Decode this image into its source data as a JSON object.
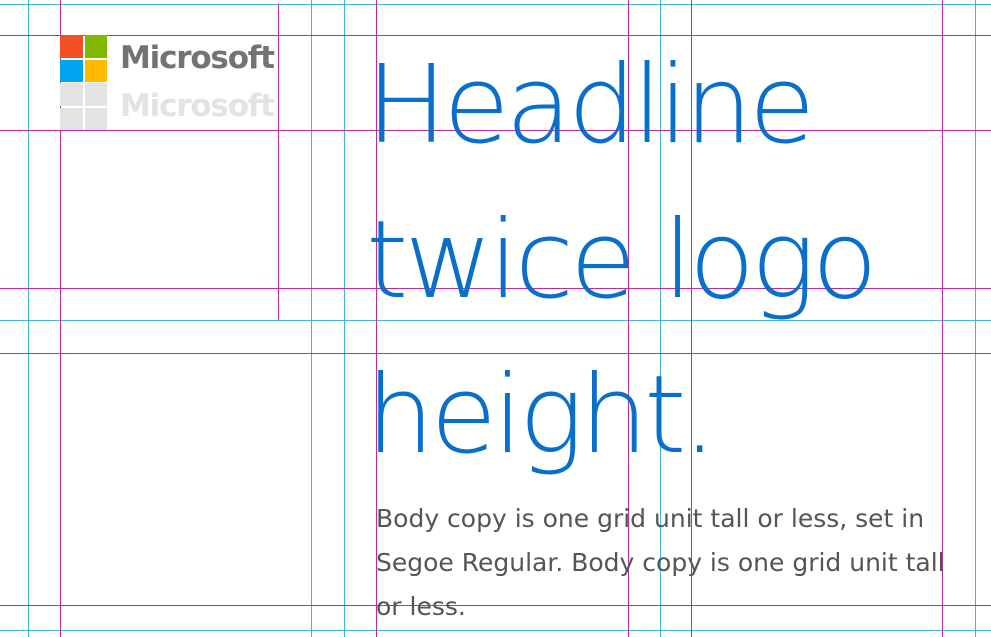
{
  "logo": {
    "wordmark": "Microsoft",
    "ghost_wordmark": "Microsoft",
    "colors": {
      "red": "#f25022",
      "green": "#7fba00",
      "blue": "#00a4ef",
      "yellow": "#ffb900",
      "wordmark": "#737373",
      "ghost": "#e3e3e3"
    }
  },
  "headline": {
    "lines": [
      "Headline",
      "twice logo",
      "height."
    ],
    "color": "#0a6fcb"
  },
  "body_copy": {
    "text": "Body copy is one grid unit tall or less, set in Segoe Regular. Body copy is one grid unit tall or less.",
    "color": "#555555"
  },
  "grid": {
    "cyan_color": "#3fb6dc",
    "magenta_color": "#c0299f"
  }
}
